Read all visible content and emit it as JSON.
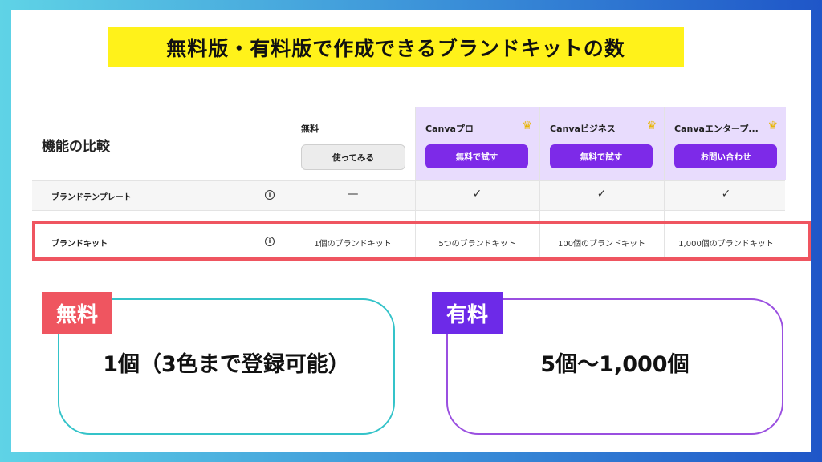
{
  "title": "無料版・有料版で作成できるブランドキットの数",
  "table": {
    "compare_title": "機能の比較",
    "plans": [
      {
        "name": "無料",
        "button": "使ってみる"
      },
      {
        "name": "Canvaプロ",
        "button": "無料で試す"
      },
      {
        "name": "Canvaビジネス",
        "button": "無料で試す"
      },
      {
        "name": "Canvaエンタープ...",
        "button": "お問い合わせ"
      }
    ],
    "rows": [
      {
        "label": "ブランドテンプレート",
        "values": [
          "—",
          "✓",
          "✓",
          "✓"
        ]
      },
      {
        "label": "ブランドキット",
        "values": [
          "1個のブランドキット",
          "5つのブランドキット",
          "100個のブランドキット",
          "1,000個のブランドキット"
        ]
      }
    ]
  },
  "free_card": {
    "tag": "無料",
    "text": "1個（3色まで登録可能）"
  },
  "paid_card": {
    "tag": "有料",
    "text": "5個〜1,000個"
  },
  "icons": {
    "crown": "crown-icon",
    "info": "info-icon"
  }
}
